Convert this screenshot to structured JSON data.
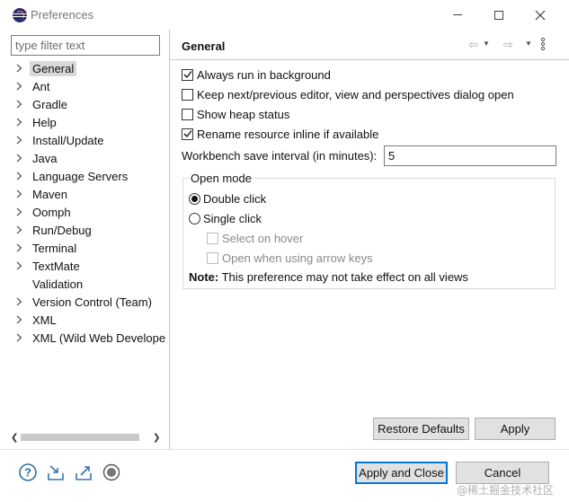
{
  "window": {
    "title": "Preferences",
    "icon": "eclipse-icon"
  },
  "sidebar": {
    "filter_placeholder": "type filter text",
    "items": [
      {
        "label": "General",
        "expandable": true,
        "selected": true
      },
      {
        "label": "Ant",
        "expandable": true,
        "selected": false
      },
      {
        "label": "Gradle",
        "expandable": true,
        "selected": false
      },
      {
        "label": "Help",
        "expandable": true,
        "selected": false
      },
      {
        "label": "Install/Update",
        "expandable": true,
        "selected": false
      },
      {
        "label": "Java",
        "expandable": true,
        "selected": false
      },
      {
        "label": "Language Servers",
        "expandable": true,
        "selected": false
      },
      {
        "label": "Maven",
        "expandable": true,
        "selected": false
      },
      {
        "label": "Oomph",
        "expandable": true,
        "selected": false
      },
      {
        "label": "Run/Debug",
        "expandable": true,
        "selected": false
      },
      {
        "label": "Terminal",
        "expandable": true,
        "selected": false
      },
      {
        "label": "TextMate",
        "expandable": true,
        "selected": false
      },
      {
        "label": "Validation",
        "expandable": false,
        "selected": false
      },
      {
        "label": "Version Control (Team)",
        "expandable": true,
        "selected": false
      },
      {
        "label": "XML",
        "expandable": true,
        "selected": false
      },
      {
        "label": "XML (Wild Web Develope",
        "expandable": true,
        "selected": false
      }
    ]
  },
  "page": {
    "title": "General",
    "options": [
      {
        "label": "Always run in background",
        "checked": true
      },
      {
        "label": "Keep next/previous editor, view and perspectives dialog open",
        "checked": false
      },
      {
        "label": "Show heap status",
        "checked": false
      },
      {
        "label": "Rename resource inline if available",
        "checked": true
      }
    ],
    "interval_label": "Workbench save interval (in minutes):",
    "interval_value": "5",
    "open_mode": {
      "title": "Open mode",
      "options": [
        {
          "label": "Double click",
          "selected": true
        },
        {
          "label": "Single click",
          "selected": false
        }
      ],
      "sub_options": [
        {
          "label": "Select on hover",
          "checked": false,
          "enabled": false
        },
        {
          "label": "Open when using arrow keys",
          "checked": false,
          "enabled": false
        }
      ],
      "note_bold": "Note:",
      "note_text": " This preference may not take effect on all views"
    }
  },
  "buttons": {
    "restore_defaults": "Restore Defaults",
    "apply": "Apply",
    "apply_and_close": "Apply and Close",
    "cancel": "Cancel"
  },
  "footer_icons": [
    "help-icon",
    "import-icon",
    "export-icon",
    "record-icon"
  ],
  "watermark": "@稀土掘金技术社区"
}
